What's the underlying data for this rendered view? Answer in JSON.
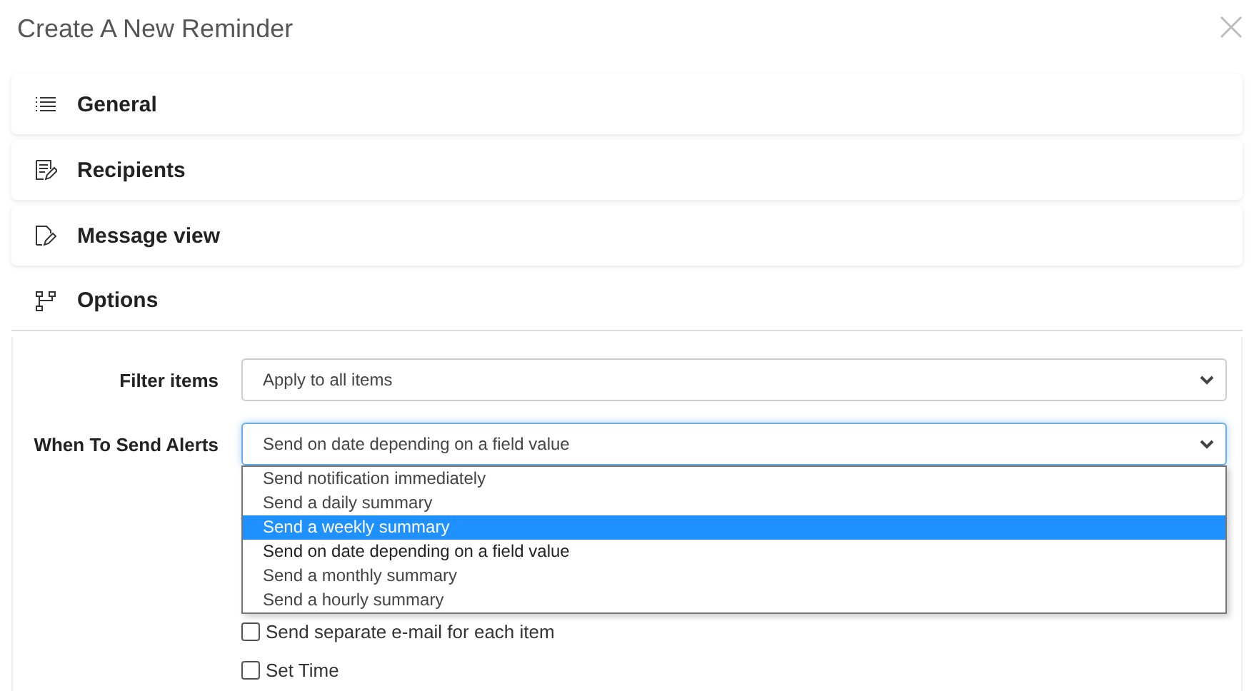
{
  "dialog": {
    "title": "Create A New Reminder"
  },
  "sections": [
    {
      "label": "General",
      "expanded": false
    },
    {
      "label": "Recipients",
      "expanded": false
    },
    {
      "label": "Message view",
      "expanded": false
    },
    {
      "label": "Options",
      "expanded": true
    }
  ],
  "options": {
    "fields": [
      {
        "label": "Filter items",
        "value": "Apply to all items",
        "focused": false
      },
      {
        "label": "When To Send Alerts",
        "value": "Send on date depending on a field value",
        "focused": true,
        "dropdown": [
          {
            "label": "Send notification immediately",
            "selected": false,
            "highlighted": false
          },
          {
            "label": "Send a daily summary",
            "selected": false,
            "highlighted": false
          },
          {
            "label": "Send a weekly summary",
            "selected": false,
            "highlighted": true
          },
          {
            "label": "Send on date depending on a field value",
            "selected": true,
            "highlighted": false
          },
          {
            "label": "Send a monthly summary",
            "selected": false,
            "highlighted": false
          },
          {
            "label": "Send a hourly summary",
            "selected": false,
            "highlighted": false
          }
        ]
      }
    ],
    "checkboxes": [
      {
        "label": "Send separate e-mail for each item",
        "checked": false
      },
      {
        "label": "Set Time",
        "checked": false
      }
    ]
  }
}
